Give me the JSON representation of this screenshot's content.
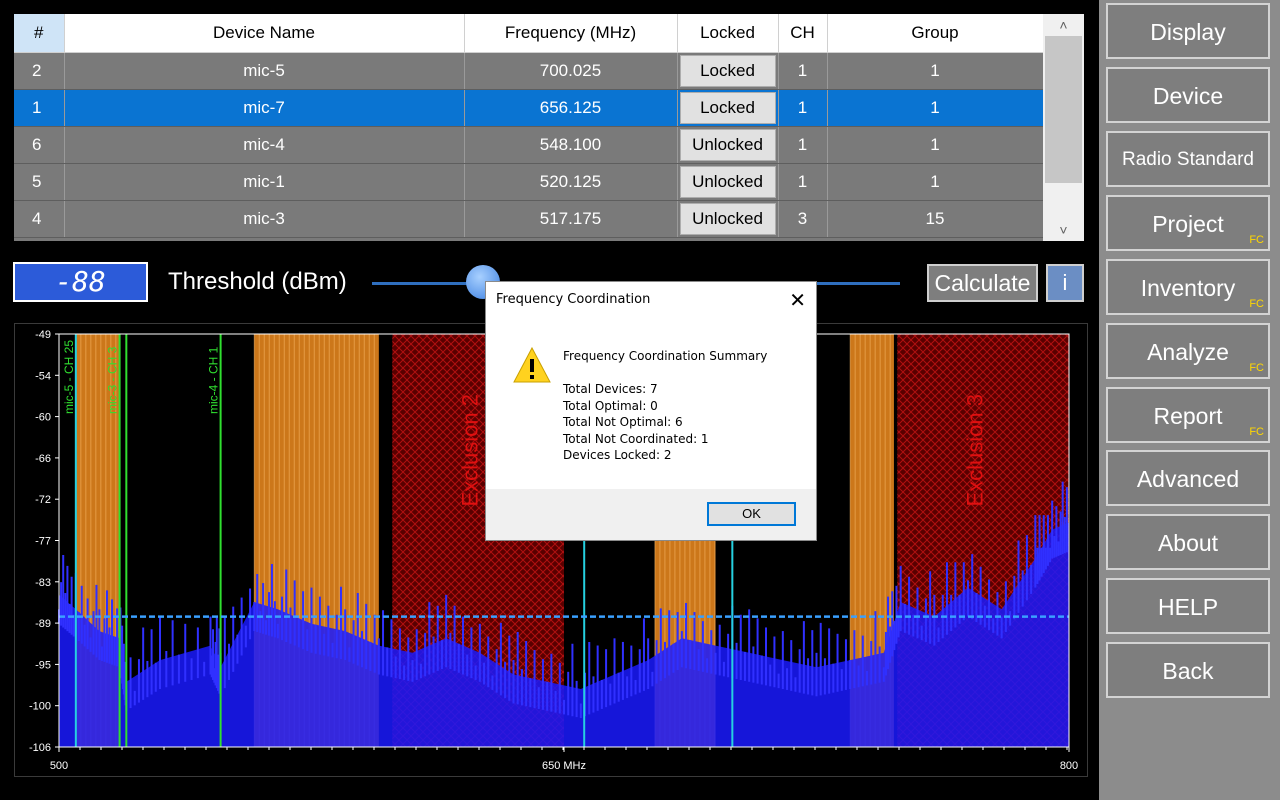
{
  "table": {
    "headers": [
      "#",
      "Device Name",
      "Frequency (MHz)",
      "Locked",
      "CH",
      "Group"
    ],
    "rows": [
      {
        "num": "2",
        "name": "mic-5",
        "freq": "700.025",
        "locked": "Locked",
        "ch": "1",
        "group": "1"
      },
      {
        "num": "1",
        "name": "mic-7",
        "freq": "656.125",
        "locked": "Locked",
        "ch": "1",
        "group": "1"
      },
      {
        "num": "6",
        "name": "mic-4",
        "freq": "548.100",
        "locked": "Unlocked",
        "ch": "1",
        "group": "1"
      },
      {
        "num": "5",
        "name": "mic-1",
        "freq": "520.125",
        "locked": "Unlocked",
        "ch": "1",
        "group": "1"
      },
      {
        "num": "4",
        "name": "mic-3",
        "freq": "517.175",
        "locked": "Unlocked",
        "ch": "3",
        "group": "15"
      }
    ],
    "selected_row": 1,
    "scroll_up_icon": "chevron-up-icon",
    "scroll_down_icon": "chevron-down-icon"
  },
  "threshold": {
    "value": "-88",
    "label": "Threshold (dBm)",
    "slider_fraction": 0.21
  },
  "calculate_label": "Calculate",
  "info_label": "i",
  "chart_data": {
    "type": "area",
    "x_ticks": [
      "500",
      "650 MHz",
      "800"
    ],
    "y_ticks": [
      "-49",
      "-54",
      "-60",
      "-66",
      "-72",
      "-77",
      "-83",
      "-89",
      "-95",
      "-100",
      "-106"
    ],
    "xlim": [
      500,
      800
    ],
    "ylim": [
      -106,
      -49
    ],
    "threshold_dbm": -88,
    "exclusions": [
      {
        "label": "Exclusion 2",
        "from": 599,
        "to": 650
      },
      {
        "label": "Exclusion 3",
        "from": 749,
        "to": 800
      }
    ],
    "channel_labels": [
      {
        "text": "mic-5 - CH 25",
        "x": 505
      },
      {
        "text": "mic-3 - CH 3",
        "x": 518
      },
      {
        "text": "mic-4 - CH 1",
        "x": 548
      }
    ],
    "device_lines_mhz": [
      505,
      518,
      520,
      548,
      656,
      700
    ],
    "orange_bands": [
      [
        505,
        518
      ],
      [
        558,
        595
      ],
      [
        677,
        695
      ],
      [
        735,
        748
      ]
    ],
    "spectrum": {
      "series": "RF scan",
      "points": [
        [
          500,
          -85
        ],
        [
          505,
          -87
        ],
        [
          512,
          -90
        ],
        [
          518,
          -91
        ],
        [
          520,
          -97
        ],
        [
          530,
          -94
        ],
        [
          545,
          -92
        ],
        [
          548,
          -95
        ],
        [
          558,
          -86
        ],
        [
          565,
          -87
        ],
        [
          575,
          -89
        ],
        [
          585,
          -90
        ],
        [
          595,
          -92
        ],
        [
          605,
          -93
        ],
        [
          615,
          -91
        ],
        [
          625,
          -93
        ],
        [
          635,
          -96
        ],
        [
          645,
          -97
        ],
        [
          655,
          -98
        ],
        [
          665,
          -96
        ],
        [
          675,
          -94
        ],
        [
          685,
          -91
        ],
        [
          695,
          -92
        ],
        [
          705,
          -93
        ],
        [
          715,
          -94
        ],
        [
          725,
          -95
        ],
        [
          735,
          -94
        ],
        [
          745,
          -93
        ],
        [
          750,
          -86
        ],
        [
          760,
          -88
        ],
        [
          770,
          -84
        ],
        [
          780,
          -87
        ],
        [
          790,
          -80
        ],
        [
          795,
          -76
        ],
        [
          800,
          -75
        ]
      ]
    }
  },
  "sidebar": {
    "items": [
      {
        "label": "Display",
        "fc": false
      },
      {
        "label": "Device",
        "fc": false
      },
      {
        "label": "Radio Standard",
        "fc": false
      },
      {
        "label": "Project",
        "fc": true
      },
      {
        "label": "Inventory",
        "fc": true
      },
      {
        "label": "Analyze",
        "fc": true
      },
      {
        "label": "Report",
        "fc": true
      },
      {
        "label": "Advanced",
        "fc": false
      },
      {
        "label": "About",
        "fc": false
      },
      {
        "label": "HELP",
        "fc": false
      },
      {
        "label": "Back",
        "fc": false
      }
    ],
    "fc_tag": "FC"
  },
  "dialog": {
    "title": "Frequency Coordination",
    "close_icon": "close-icon",
    "warning_icon": "warning-icon",
    "heading": "Frequency Coordination Summary",
    "lines": [
      "Total Devices: 7",
      "Total Optimal: 0",
      "Total Not Optimal: 6",
      "Total Not Coordinated: 1",
      "Devices Locked: 2"
    ],
    "ok_label": "OK"
  },
  "colors": {
    "selection": "#0a74d2",
    "spectrum": "#1a1aff",
    "orange_band": "#f08c1e",
    "exclusion": "#7a0000",
    "threshold_line": "#3aa0ff"
  }
}
